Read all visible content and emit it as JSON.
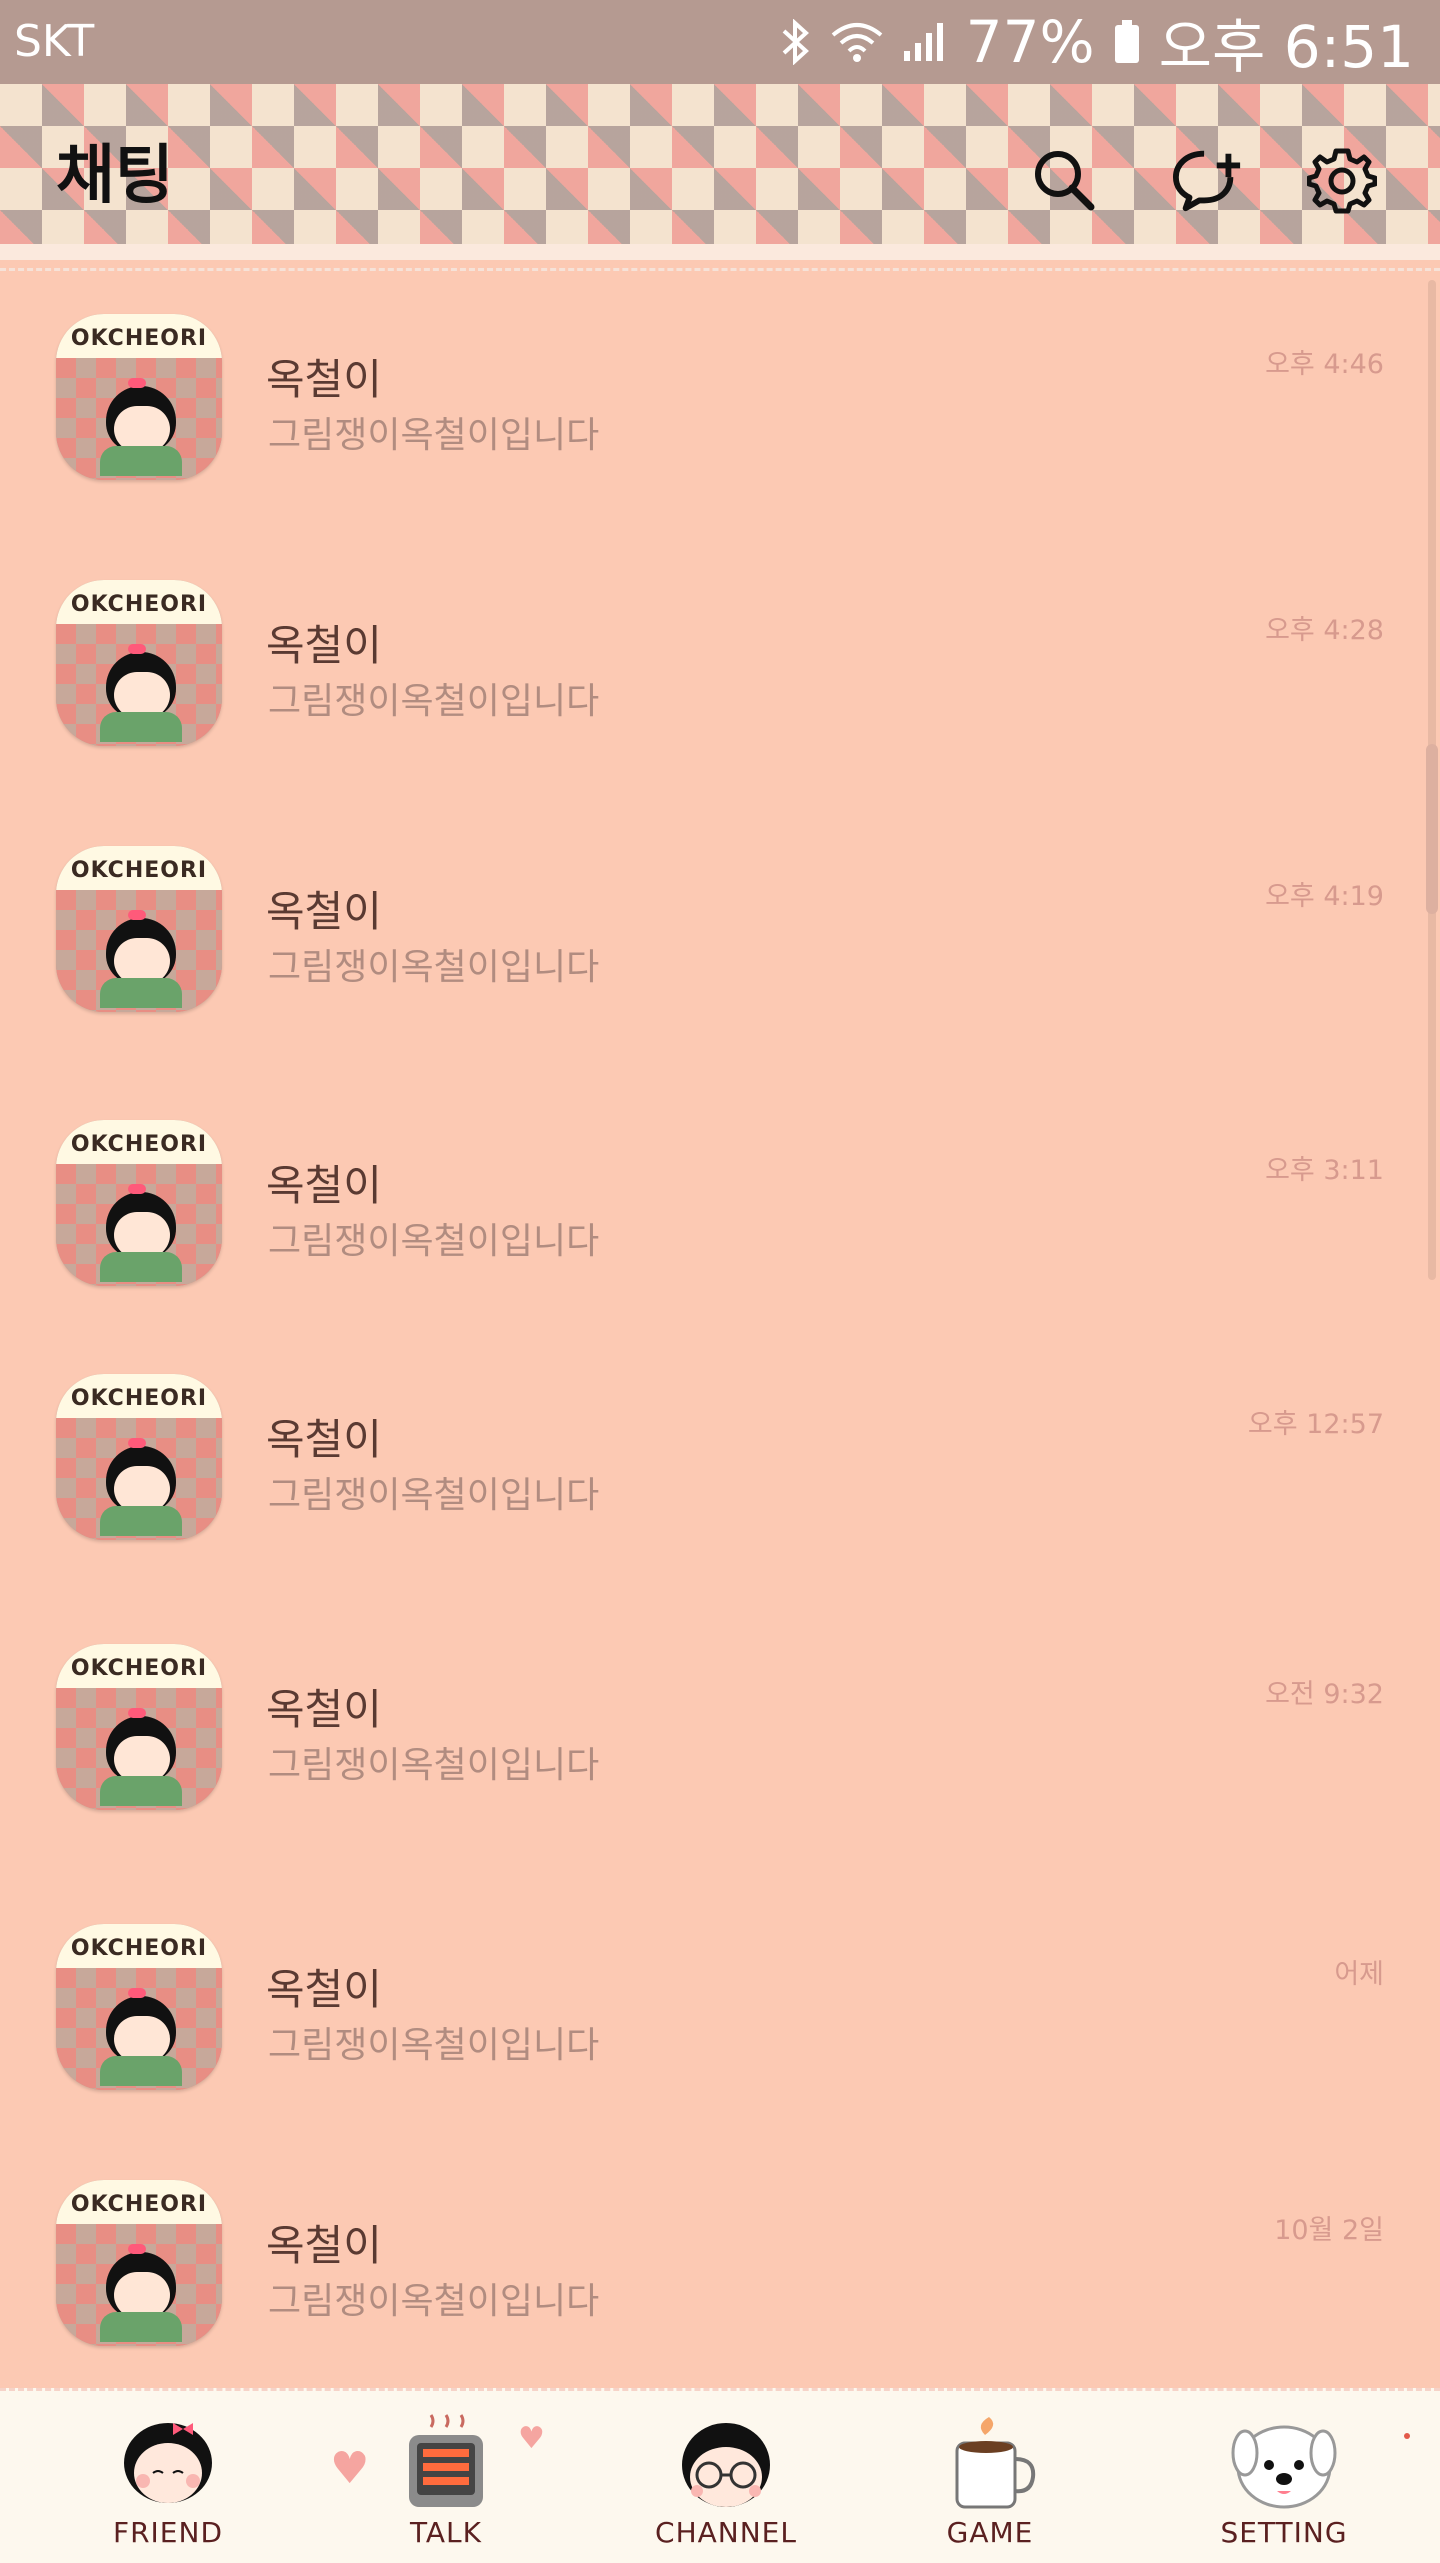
{
  "status_bar": {
    "carrier": "SKT",
    "battery": "77%",
    "clock": "오후 6:51"
  },
  "header": {
    "title": "채팅",
    "icons": [
      "search-icon",
      "new-chat-icon",
      "settings-icon"
    ]
  },
  "chats": [
    {
      "name": "옥철이",
      "message": "그림쟁이옥철이입니다",
      "time": "오후 4:46",
      "avatar_text": "OKCHEORI"
    },
    {
      "name": "옥철이",
      "message": "그림쟁이옥철이입니다",
      "time": "오후 4:28",
      "avatar_text": "OKCHEORI"
    },
    {
      "name": "옥철이",
      "message": "그림쟁이옥철이입니다",
      "time": "오후 4:19",
      "avatar_text": "OKCHEORI"
    },
    {
      "name": "옥철이",
      "message": "그림쟁이옥철이입니다",
      "time": "오후 3:11",
      "avatar_text": "OKCHEORI"
    },
    {
      "name": "옥철이",
      "message": "그림쟁이옥철이입니다",
      "time": "오후 12:57",
      "avatar_text": "OKCHEORI"
    },
    {
      "name": "옥철이",
      "message": "그림쟁이옥철이입니다",
      "time": "오전 9:32",
      "avatar_text": "OKCHEORI"
    },
    {
      "name": "옥철이",
      "message": "그림쟁이옥철이입니다",
      "time": "어제",
      "avatar_text": "OKCHEORI"
    },
    {
      "name": "옥철이",
      "message": "그림쟁이옥철이입니다",
      "time": "10월 2일",
      "avatar_text": "OKCHEORI"
    }
  ],
  "nav": [
    {
      "label": "FRIEND",
      "icon": "girl-face-icon"
    },
    {
      "label": "TALK",
      "icon": "heater-icon"
    },
    {
      "label": "CHANNEL",
      "icon": "boy-glasses-icon"
    },
    {
      "label": "GAME",
      "icon": "coffee-cup-icon"
    },
    {
      "label": "SETTING",
      "icon": "puppy-icon"
    }
  ],
  "colors": {
    "background": "#fcc9b3",
    "status_bar": "#b59a91",
    "name_text": "#5a3a32",
    "message_text": "#b18c80",
    "time_text": "#d79a8e",
    "nav_background": "#fdf8ee"
  }
}
